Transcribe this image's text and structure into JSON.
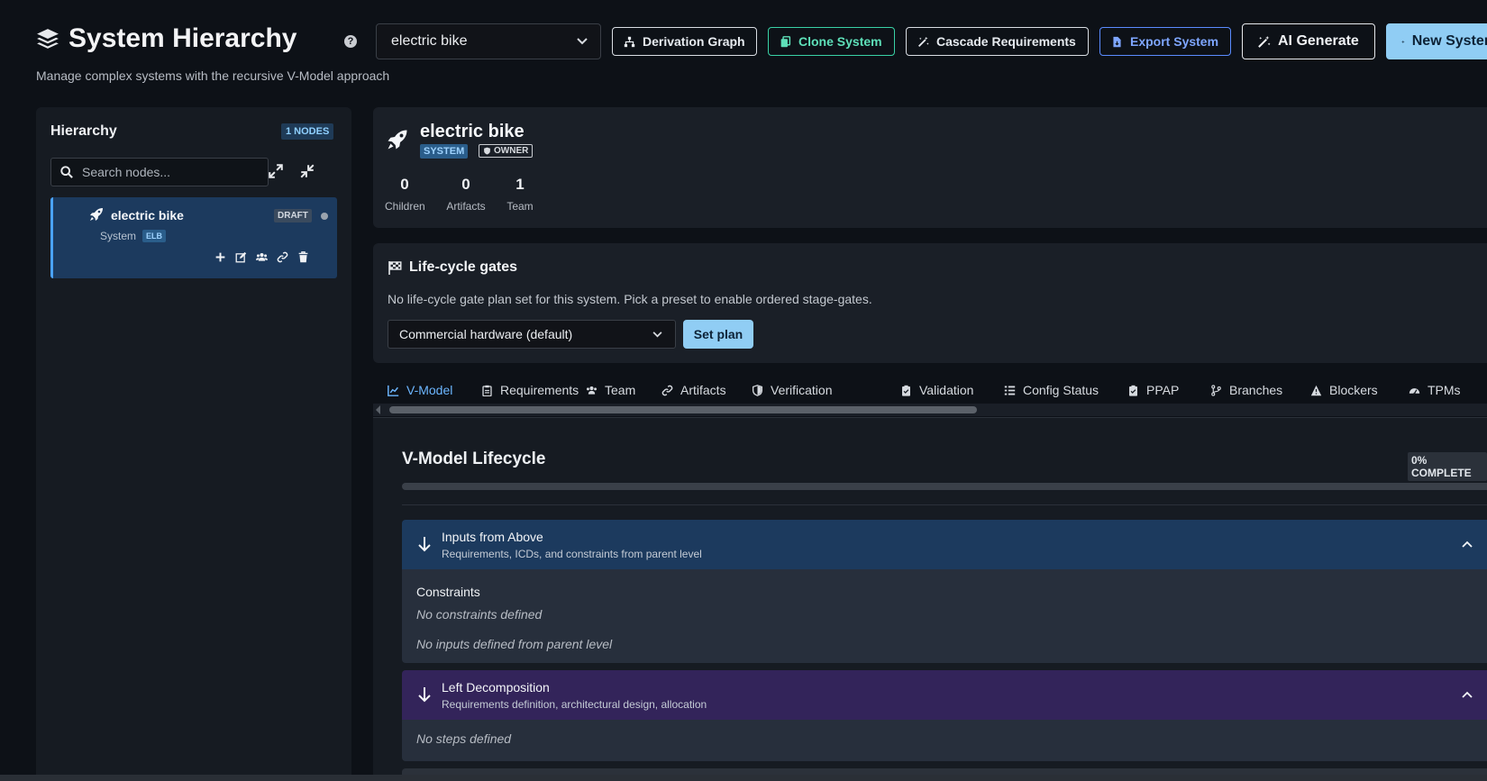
{
  "header": {
    "title": "System Hierarchy",
    "subtitle": "Manage complex systems with the recursive V-Model approach",
    "help_glyph": "?",
    "system_select": "electric bike"
  },
  "toolbar": {
    "derivation_graph": "Derivation Graph",
    "clone_system": "Clone System",
    "cascade_requirements": "Cascade Requirements",
    "export_system": "Export System",
    "ai_generate": "AI Generate",
    "new_system": "New System"
  },
  "colors": {
    "accent": "#90cdf4",
    "background": "#0d1117",
    "node_selected": "#1c3a5e",
    "clone_green": "#39d2a6",
    "export_blue": "#5a8cff"
  },
  "sidebar": {
    "title": "Hierarchy",
    "nodes_badge": "1 NODES",
    "search_placeholder": "Search nodes...",
    "expand_icon": "expand-icon",
    "collapse_icon": "collapse-icon",
    "node": {
      "name": "electric bike",
      "status": "DRAFT",
      "type": "System",
      "abbr": "ELB"
    }
  },
  "system_card": {
    "name": "electric bike",
    "tag_system": "SYSTEM",
    "tag_owner": "OWNER",
    "stats": [
      {
        "value": "0",
        "label": "Children"
      },
      {
        "value": "0",
        "label": "Artifacts"
      },
      {
        "value": "1",
        "label": "Team"
      }
    ]
  },
  "gates": {
    "title": "Life-cycle gates",
    "description": "No life-cycle gate plan set for this system. Pick a preset to enable ordered stage-gates.",
    "preset": "Commercial hardware (default)",
    "set_plan": "Set plan"
  },
  "tabs": [
    {
      "label": "V-Model",
      "icon": "chart-line-icon",
      "active": true
    },
    {
      "label": "Requirements",
      "icon": "clipboard-icon"
    },
    {
      "label": "Team",
      "icon": "users-icon"
    },
    {
      "label": "Artifacts",
      "icon": "link-icon"
    },
    {
      "label": "Verification",
      "icon": "shield-icon"
    },
    {
      "label": "Validation",
      "icon": "clipboard-check-icon"
    },
    {
      "label": "Config Status",
      "icon": "list-icon"
    },
    {
      "label": "PPAP",
      "icon": "clipboard-check-icon"
    },
    {
      "label": "Branches",
      "icon": "branch-icon"
    },
    {
      "label": "Blockers",
      "icon": "warning-icon"
    },
    {
      "label": "TPMs",
      "icon": "gauge-icon"
    }
  ],
  "vmodel": {
    "title": "V-Model Lifecycle",
    "complete_badge": "0% COMPLETE",
    "progress": 0,
    "sections": [
      {
        "title": "Inputs from Above",
        "subtitle": "Requirements, ICDs, and constraints from parent level",
        "constraints_label": "Constraints",
        "constraints_empty": "No constraints defined",
        "empty": "No inputs defined from parent level"
      },
      {
        "title": "Left Decomposition",
        "subtitle": "Requirements definition, architectural design, allocation",
        "empty": "No steps defined"
      }
    ]
  }
}
